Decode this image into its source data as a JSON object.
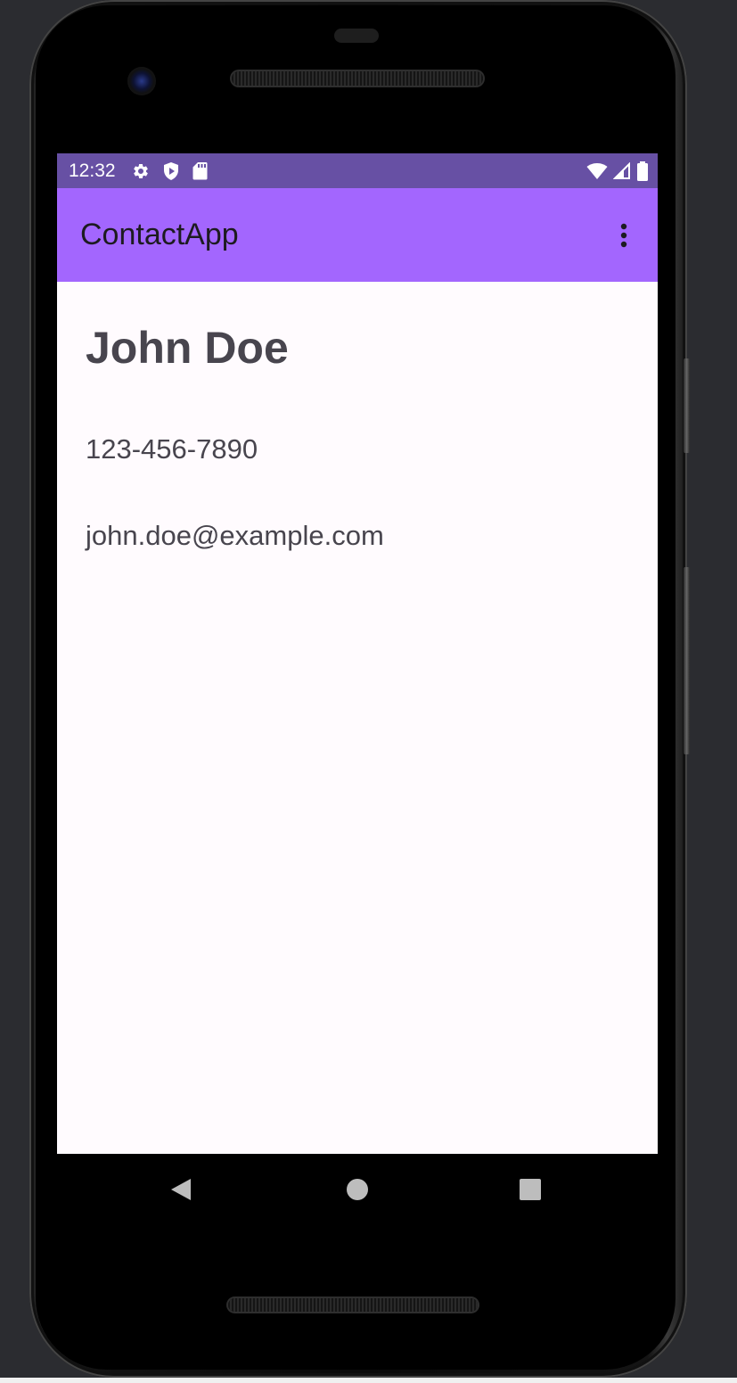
{
  "status_bar": {
    "time": "12:32",
    "left_icons": [
      "gear-icon",
      "shield-play-icon",
      "sd-card-icon"
    ],
    "right_icons": [
      "wifi-icon",
      "cell-signal-icon",
      "battery-icon"
    ]
  },
  "app_bar": {
    "title": "ContactApp",
    "overflow_icon": "more-vert-icon"
  },
  "contact": {
    "name": "John Doe",
    "phone": "123-456-7890",
    "email": "john.doe@example.com"
  },
  "nav_bar": {
    "buttons": [
      "back-icon",
      "home-icon",
      "recents-icon"
    ]
  },
  "colors": {
    "status_bar": "#6750a4",
    "app_bar": "#a366fe",
    "screen_background": "#fffbfe",
    "text": "#48454e"
  }
}
